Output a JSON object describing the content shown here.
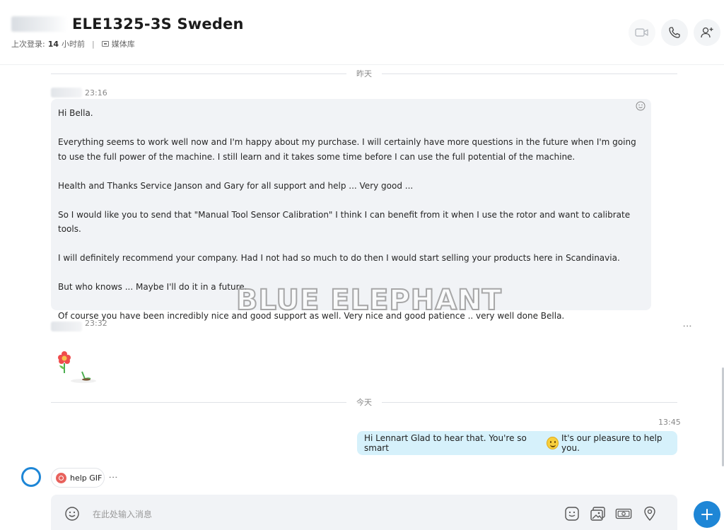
{
  "header": {
    "title": "ELE1325-3S Sweden",
    "last_seen_label": "上次登录:",
    "last_seen_value": "14",
    "last_seen_unit": "小时前",
    "separator": "|",
    "media_label": "媒体库"
  },
  "header_icons": [
    "video-call-icon",
    "audio-call-icon",
    "add-person-icon"
  ],
  "separators": {
    "yesterday": "昨天",
    "today": "今天"
  },
  "messages": {
    "incoming_1": {
      "time": "23:16",
      "paragraphs": [
        "Hi Bella.",
        "Everything seems to work well now and I'm happy about my purchase. I will certainly have more questions in the future when I'm going to use the full power of the machine. I still learn and it takes some time before I can use the full potential of the machine.",
        "Health and Thanks Service Janson and Gary for all support and help ... Very good ...",
        "So I would like you to send that \"Manual Tool Sensor Calibration\" I think I can benefit from it when I use the rotor and want to calibrate tools.",
        "I will definitely recommend your company. Had I not had so much to do then I would start selling your products here in Scandinavia.",
        "But who knows ... Maybe I'll do it in a future.",
        "Of course you have been incredibly nice and good support as well. Very nice and good patience .. very well done Bella."
      ]
    },
    "incoming_2": {
      "time": "23:32"
    },
    "outgoing_1": {
      "time": "13:45",
      "text_before": "Hi Lennart Glad to hear that. You're so smart",
      "text_after": "It's our pleasure to help you."
    }
  },
  "watermark": "BLUE ELEPHANT",
  "suggestion_chip": {
    "label": "help GIF"
  },
  "compose": {
    "placeholder": "在此处输入消息"
  },
  "colors": {
    "accent": "#1e86d6",
    "incoming_bubble": "#f1f3f6",
    "outgoing_bubble": "#d6f1fb"
  }
}
